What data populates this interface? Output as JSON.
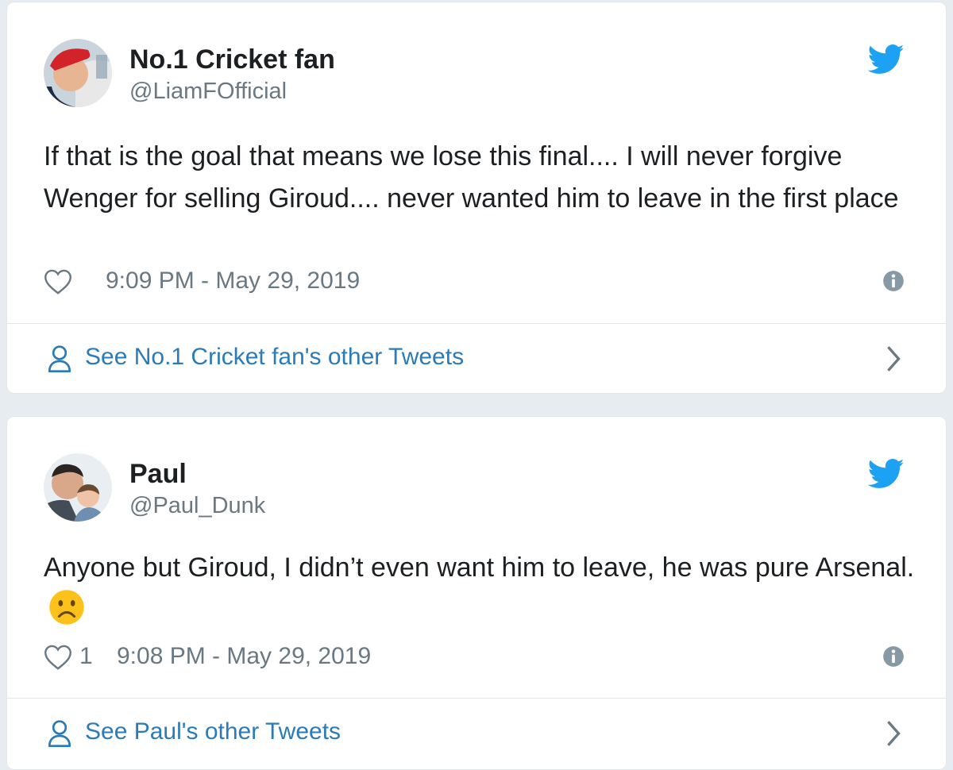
{
  "tweets": [
    {
      "display_name": "No.1 Cricket fan",
      "handle": "@LiamFOfficial",
      "text": "If that is the goal that means we lose this final.... I will never forgive Wenger for selling Giroud.... never wanted him to leave in the first place",
      "likes": "",
      "timestamp": "9:09 PM - May 29, 2019",
      "footer_link": "See No.1 Cricket fan's other Tweets",
      "avatar_desc": "avatar"
    },
    {
      "display_name": "Paul",
      "handle": "@Paul_Dunk",
      "text": "Anyone but Giroud, I didn’t even want him to leave, he was pure Arsenal.",
      "likes": "1",
      "timestamp": "9:08 PM - May 29, 2019",
      "footer_link": "See Paul's other Tweets",
      "emoji": "frowning-face"
    }
  ],
  "colors": {
    "twitter_blue": "#1da1f2",
    "link_blue": "#2b7bb9",
    "muted_gray": "#697882",
    "text": "#1c2022",
    "background": "#e6ecf0"
  },
  "icons": [
    "twitter-bird-icon",
    "heart-icon",
    "info-icon",
    "person-icon",
    "chevron-right-icon",
    "frowning-face-emoji"
  ]
}
